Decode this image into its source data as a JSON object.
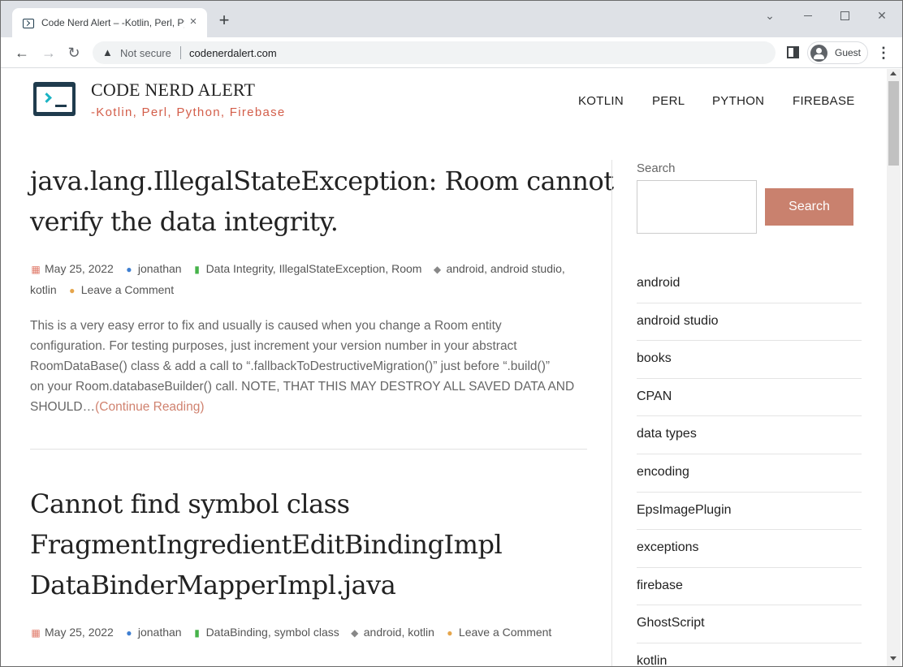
{
  "browser": {
    "tab_title": "Code Nerd Alert – -Kotlin, Perl, Python, Firebase",
    "tab_close": "×",
    "new_tab": "+",
    "not_secure": "Not secure",
    "url": "codenerdalert.com",
    "profile": "Guest",
    "icons": {
      "back": "←",
      "forward": "→",
      "reload": "↻",
      "warning": "▲",
      "menu": "⋮",
      "chevron": "⌄",
      "close": "✕"
    }
  },
  "site": {
    "title": "CODE NERD ALERT",
    "tagline": "-Kotlin, Perl, Python, Firebase",
    "nav": [
      "KOTLIN",
      "PERL",
      "PYTHON",
      "FIREBASE"
    ]
  },
  "posts": [
    {
      "title_lines": [
        "java.lang.IllegalStateException: Room cannot",
        "verify the data integrity."
      ],
      "date": "May 25, 2022",
      "author": "jonathan",
      "categories": "Data Integrity, IllegalStateException, Room",
      "tags_line1": "android, android studio,",
      "tags_line2": "kotlin",
      "comment": "Leave a Comment",
      "excerpt_lines": [
        "This is a very easy error to fix and usually is caused when you change a Room entity",
        "configuration. For testing purposes, just increment your version number in your abstract",
        "RoomDataBase() class & add a call to “.fallbackToDestructiveMigration()” just before “.build()”",
        "on your Room.databaseBuilder() call. NOTE, THAT THIS MAY DESTROY ALL SAVED DATA AND",
        "SHOULD…"
      ],
      "more": "(Continue Reading)"
    },
    {
      "title_lines": [
        "Cannot find symbol class",
        "FragmentIngredientEditBindingImpl",
        "DataBinderMapperImpl.java"
      ],
      "date": "May 25, 2022",
      "author": "jonathan",
      "categories": "DataBinding, symbol class",
      "tags": "android, kotlin",
      "comment": "Leave a Comment"
    }
  ],
  "sidebar": {
    "search_label": "Search",
    "search_value": "",
    "search_button": "Search",
    "tags": [
      "android",
      "android studio",
      "books",
      "CPAN",
      "data types",
      "encoding",
      "EpsImagePlugin",
      "exceptions",
      "firebase",
      "GhostScript",
      "kotlin"
    ]
  }
}
